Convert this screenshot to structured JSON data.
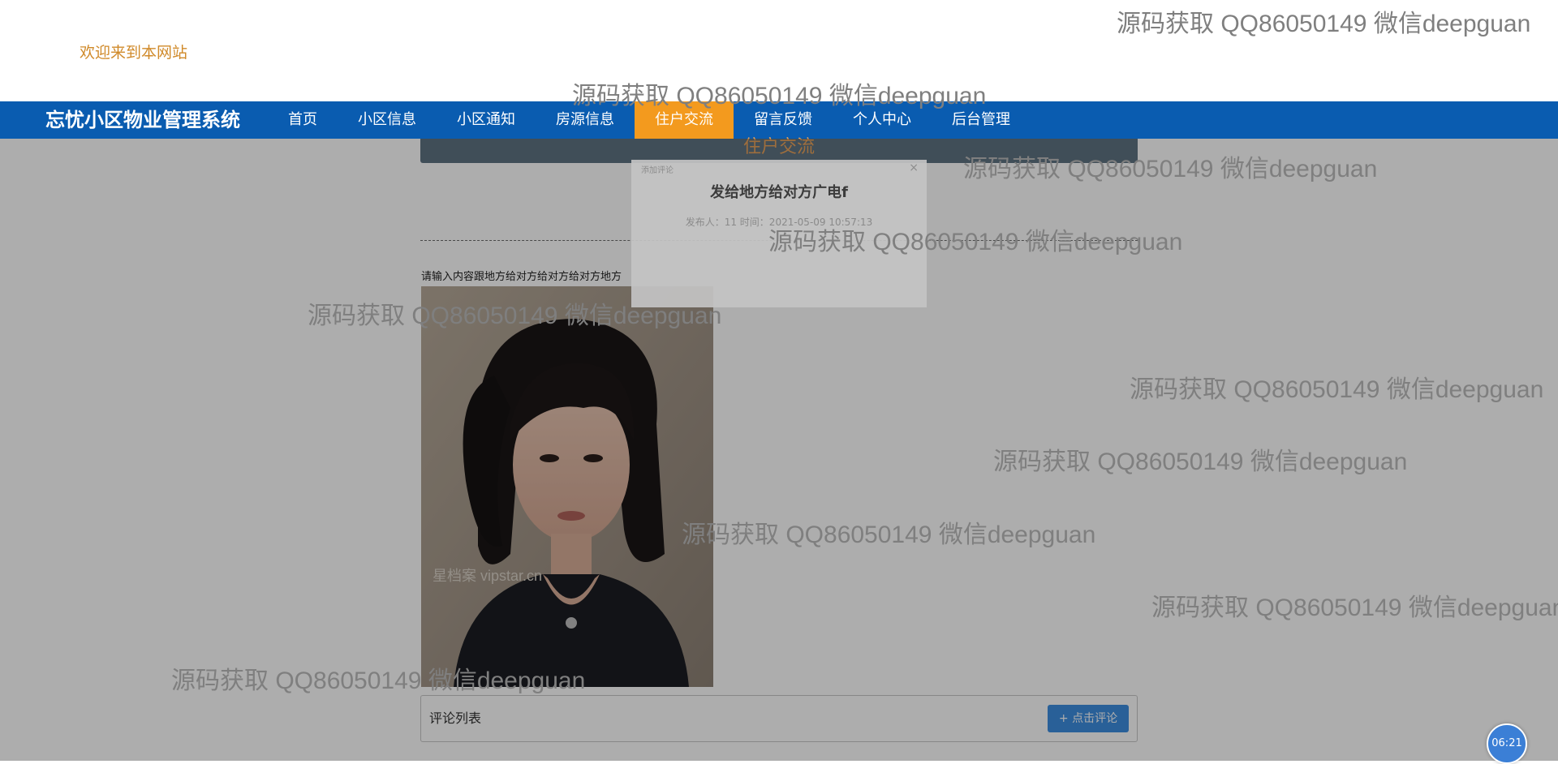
{
  "header": {
    "welcome": "欢迎来到本网站"
  },
  "nav": {
    "brand": "忘忧小区物业管理系统",
    "items": [
      {
        "label": "首页",
        "active": false
      },
      {
        "label": "小区信息",
        "active": false
      },
      {
        "label": "小区通知",
        "active": false
      },
      {
        "label": "房源信息",
        "active": false
      },
      {
        "label": "住户交流",
        "active": true
      },
      {
        "label": "留言反馈",
        "active": false
      },
      {
        "label": "个人中心",
        "active": false
      },
      {
        "label": "后台管理",
        "active": false
      }
    ],
    "colors": {
      "bar": "#0a5cb0",
      "active": "#f39a1e"
    }
  },
  "main": {
    "section_title": "住户交流",
    "prompt": "请输入内容跟地方给对方给对方给对方地方",
    "photo_caption": "星档案 vipstar.cn",
    "comments": {
      "label": "评论列表",
      "button": "+ 点击评论",
      "button_icon": "plus-icon"
    }
  },
  "modal": {
    "header": "添加评论",
    "title": "发给地方给对方广电f",
    "meta": "发布人：11 时间：2021-05-09 10:57:13",
    "close": "×"
  },
  "watermark": "源码获取 QQ86050149 微信deepguan",
  "clock": "06:21"
}
